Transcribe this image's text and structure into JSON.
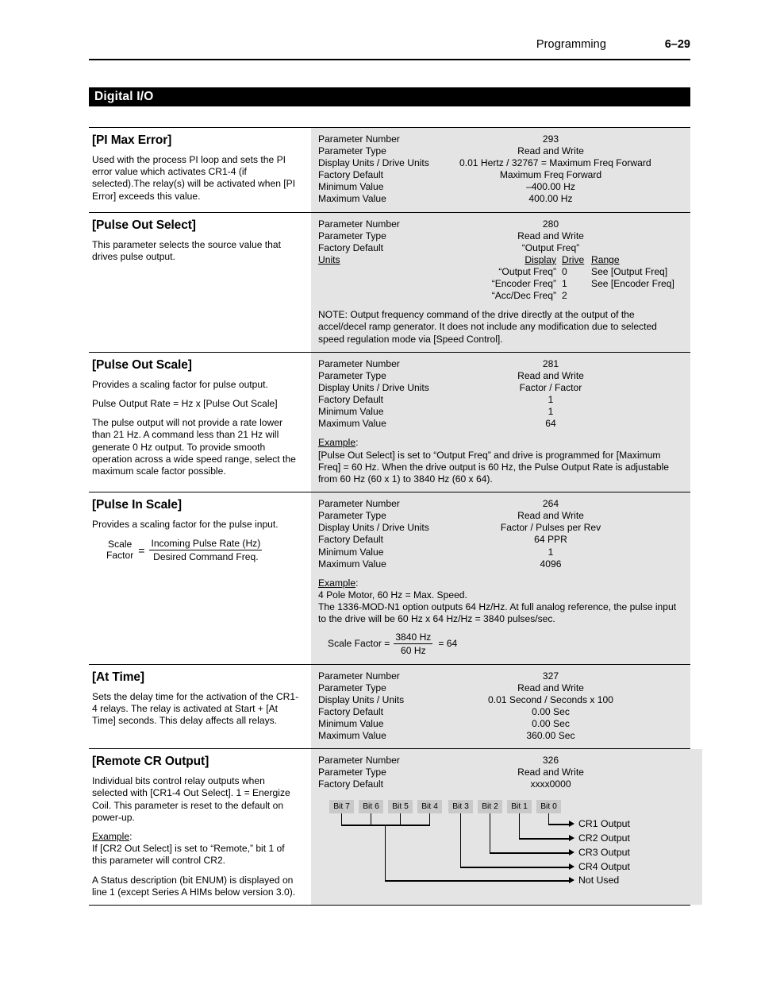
{
  "header": {
    "chapter": "Programming",
    "page_number": "6–29"
  },
  "section": {
    "title": "Digital I/O"
  },
  "labels": {
    "parameter_number": "Parameter Number",
    "parameter_type": "Parameter Type",
    "display_units_drive_units": "Display Units / Drive Units",
    "display_units_units": "Display Units / Units",
    "factory_default": "Factory Default",
    "minimum_value": "Minimum Value",
    "maximum_value": "Maximum Value",
    "units": "Units",
    "example": "Example",
    "colon": ":",
    "equals": "=",
    "display_col": "Display",
    "drive_col": "Drive",
    "range_col": "Range"
  },
  "parameters": [
    {
      "title": "[PI Max Error]",
      "description": "Used with the process PI loop and sets the PI error value which activates CR1-4 (if selected).The relay(s) will be activated when [PI Error] exceeds this value.",
      "number": "293",
      "type": "Read and Write",
      "units_line": "0.01 Hertz / 32767 = Maximum Freq Forward",
      "default": "Maximum Freq Forward",
      "minimum": "–400.00 Hz",
      "maximum": "400.00 Hz"
    },
    {
      "title": "[Pulse Out Select]",
      "description": "This parameter selects the source value that drives pulse output.",
      "number": "280",
      "type": "Read and Write",
      "default": "“Output Freq”",
      "enum_rows": [
        {
          "display": "“Output Freq”",
          "drive": "0",
          "range": "See [Output Freq]"
        },
        {
          "display": "“Encoder Freq”",
          "drive": "1",
          "range": "See [Encoder Freq]"
        },
        {
          "display": "“Acc/Dec Freq”",
          "drive": "2",
          "range": ""
        }
      ],
      "note": "NOTE: Output frequency command of the drive directly at the output of the accel/decel ramp generator. It does not include any modification due to selected speed regulation mode via [Speed Control]."
    },
    {
      "title": "[Pulse Out Scale]",
      "description_1": "Provides a scaling factor for pulse output.",
      "description_2": "Pulse Output Rate = Hz x [Pulse Out Scale]",
      "description_3": "The pulse output will not provide a rate lower than 21 Hz. A command less than 21 Hz will generate 0 Hz output. To provide smooth operation across a wide speed range, select the maximum scale factor possible.",
      "number": "281",
      "type": "Read and Write",
      "units_line": "Factor / Factor",
      "default": "1",
      "minimum": "1",
      "maximum": "64",
      "example_text": "[Pulse Out Select] is set to “Output Freq” and drive is programmed for [Maximum Freq] = 60 Hz. When the drive output is 60 Hz, the Pulse Output Rate is adjustable from 60 Hz (60 x 1) to 3840 Hz (60 x 64)."
    },
    {
      "title": "[Pulse In Scale]",
      "description": "Provides a scaling factor for the pulse input.",
      "formula": {
        "label_top": "Scale",
        "label_bottom": "Factor",
        "numerator": "Incoming Pulse Rate (Hz)",
        "denominator": "Desired Command Freq."
      },
      "number": "264",
      "type": "Read and Write",
      "units_line": "Factor / Pulses per Rev",
      "default": "64 PPR",
      "minimum": "1",
      "maximum": "4096",
      "example_line_1": "4 Pole Motor, 60 Hz = Max. Speed.",
      "example_line_2": "The 1336-MOD-N1 option outputs 64 Hz/Hz. At full analog reference, the pulse input to the drive will be 60 Hz x 64 Hz/Hz = 3840 pulses/sec.",
      "example_formula": {
        "label": "Scale Factor =",
        "numerator": "3840 Hz",
        "denominator": "60 Hz",
        "result": "= 64"
      }
    },
    {
      "title": "[At Time]",
      "description": "Sets the delay time for the activation of the CR1-4 relays. The relay is activated at Start + [At Time] seconds. This delay affects all relays.",
      "number": "327",
      "type": "Read and Write",
      "units_line": "0.01 Second / Seconds x 100",
      "default": "0.00 Sec",
      "minimum": "0.00 Sec",
      "maximum": "360.00 Sec"
    },
    {
      "title": "[Remote CR Output]",
      "description_1": "Individual bits control relay outputs when selected with [CR1-4 Out Select]. 1 = Energize Coil. This parameter is reset to the default on power-up.",
      "example_body": "If [CR2 Out Select] is set to “Remote,” bit 1 of this parameter will control CR2.",
      "description_2": "A Status description (bit ENUM) is displayed on line 1 (except Series A HIMs below version 3.0).",
      "number": "326",
      "type": "Read and Write",
      "default": "xxxx0000",
      "bit_diagram": {
        "bits": [
          "Bit 7",
          "Bit 6",
          "Bit 5",
          "Bit 4",
          "Bit 3",
          "Bit 2",
          "Bit 1",
          "Bit 0"
        ],
        "targets": [
          "CR1 Output",
          "CR2 Output",
          "CR3 Output",
          "CR4 Output",
          "Not Used"
        ]
      }
    }
  ],
  "colors": {
    "spec_panel_bg": "#e4e4e4",
    "bit_box_bg": "#c9c9c9",
    "bar_bg": "#000000",
    "text": "#000000"
  }
}
